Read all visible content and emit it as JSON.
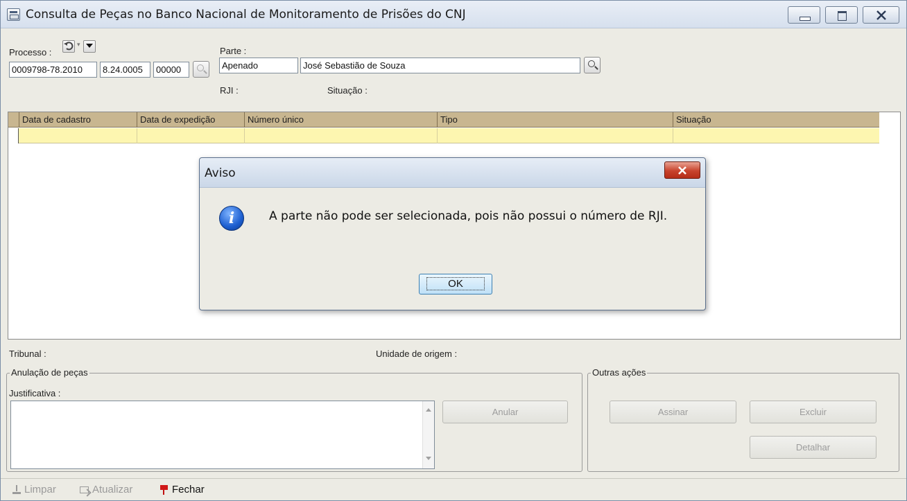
{
  "window": {
    "title": "Consulta de Peças no Banco Nacional de Monitoramento de Prisões do CNJ"
  },
  "processo": {
    "label": "Processo :",
    "seg1": "0009798-78.2010",
    "seg2": "8.24.0005",
    "seg3": "00000"
  },
  "parte": {
    "label": "Parte :",
    "tipo": "Apenado",
    "nome": "José Sebastião de Souza"
  },
  "info": {
    "rji_label": "RJI :",
    "situacao_label": "Situação :"
  },
  "table": {
    "columns": [
      "Data de cadastro",
      "Data de expedição",
      "Número único",
      "Tipo",
      "Situação"
    ]
  },
  "footer_info": {
    "tribunal_label": "Tribunal :",
    "unidade_label": "Unidade de origem :"
  },
  "anulacao": {
    "title": "Anulação de peças",
    "justificativa_label": "Justificativa :",
    "anular_button": "Anular"
  },
  "outras": {
    "title": "Outras ações",
    "assinar_button": "Assinar",
    "excluir_button": "Excluir",
    "detalhar_button": "Detalhar"
  },
  "toolbar": {
    "limpar": "Limpar",
    "atualizar": "Atualizar",
    "fechar": "Fechar"
  },
  "dialog": {
    "title": "Aviso",
    "message": "A parte não pode ser selecionada, pois não possui o número de RJI.",
    "ok_button": "OK"
  }
}
